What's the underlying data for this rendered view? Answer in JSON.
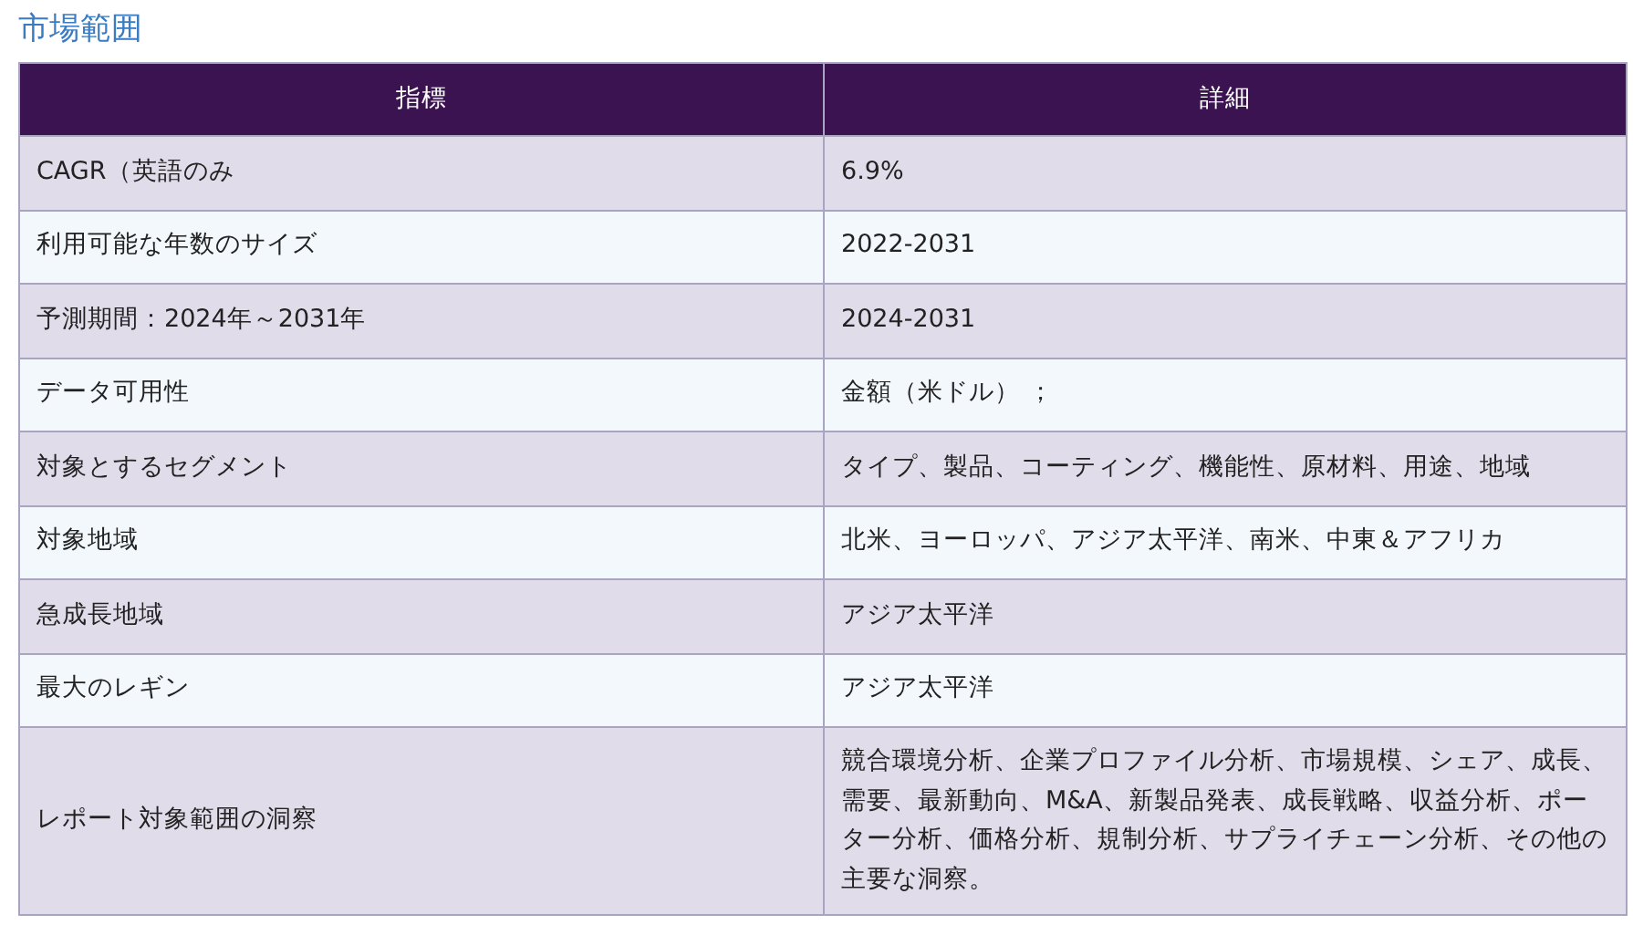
{
  "heading": "市場範囲",
  "table": {
    "columns": [
      "指標",
      "詳細"
    ],
    "rows": [
      [
        "CAGR（英語のみ",
        "6.9%"
      ],
      [
        "利用可能な年数のサイズ",
        "2022-2031"
      ],
      [
        "予測期間：2024年～2031年",
        "2024-2031"
      ],
      [
        "データ可用性",
        "金額（米ドル）  ；"
      ],
      [
        "対象とするセグメント",
        "タイプ、製品、コーティング、機能性、原材料、用途、地域"
      ],
      [
        "対象地域",
        "北米、ヨーロッパ、アジア太平洋、南米、中東＆アフリカ"
      ],
      [
        "急成長地域",
        "アジア太平洋"
      ],
      [
        "最大のレギン",
        "アジア太平洋"
      ],
      [
        "レポート対象範囲の洞察",
        "競合環境分析、企業プロファイル分析、市場規模、シェア、成長、需要、最新動向、M&A、新製品発表、成長戦略、収益分析、ポーター分析、価格分析、規制分析、サプライチェーン分析、その他の主要な洞察。"
      ]
    ]
  }
}
